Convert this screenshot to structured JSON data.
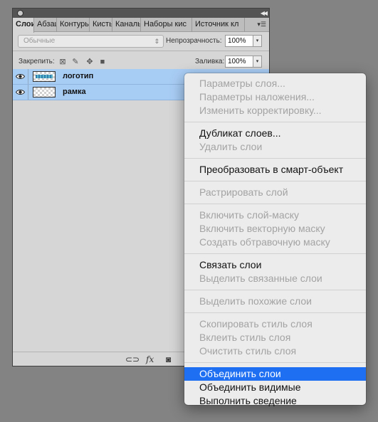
{
  "panel": {
    "tabs": [
      "Слои",
      "Абзац",
      "Контуры",
      "Кисть",
      "Каналы",
      "Наборы кис",
      "Источник кл"
    ],
    "blend_mode": "Обычные",
    "opacity_label": "Непрозрачность:",
    "opacity_value": "100%",
    "lock_label": "Закрепить:",
    "fill_label": "Заливка:",
    "fill_value": "100%",
    "layers": [
      {
        "name": "логотип",
        "selected": true,
        "visible": true
      },
      {
        "name": "рамка",
        "selected": true,
        "visible": true
      }
    ],
    "footer_icons": [
      "link-icon",
      "fx-icon",
      "mask-icon"
    ]
  },
  "menu": {
    "items": [
      {
        "label": "Параметры слоя...",
        "enabled": false
      },
      {
        "label": "Параметры наложения...",
        "enabled": false
      },
      {
        "label": "Изменить корректировку...",
        "enabled": false
      },
      {
        "label": "Дубликат слоев...",
        "enabled": true
      },
      {
        "label": "Удалить слои",
        "enabled": false
      },
      {
        "label": "Преобразовать в смарт-объект",
        "enabled": true
      },
      {
        "label": "Растрировать слой",
        "enabled": false
      },
      {
        "label": "Включить слой-маску",
        "enabled": false
      },
      {
        "label": "Включить векторную маску",
        "enabled": false
      },
      {
        "label": "Создать обтравочную маску",
        "enabled": false
      },
      {
        "label": "Связать слои",
        "enabled": true
      },
      {
        "label": "Выделить связанные слои",
        "enabled": false
      },
      {
        "label": "Выделить похожие слои",
        "enabled": false
      },
      {
        "label": "Скопировать стиль слоя",
        "enabled": false
      },
      {
        "label": "Вклеить стиль слоя",
        "enabled": false
      },
      {
        "label": "Очистить стиль слоя",
        "enabled": false
      },
      {
        "label": "Объединить слои",
        "enabled": true,
        "highlighted": true
      },
      {
        "label": "Объединить видимые",
        "enabled": true
      },
      {
        "label": "Выполнить сведение",
        "enabled": true
      }
    ]
  },
  "colors": {
    "desktop": "#838383",
    "selection": "#a8cdf5",
    "menu_highlight": "#1e6ff1"
  }
}
